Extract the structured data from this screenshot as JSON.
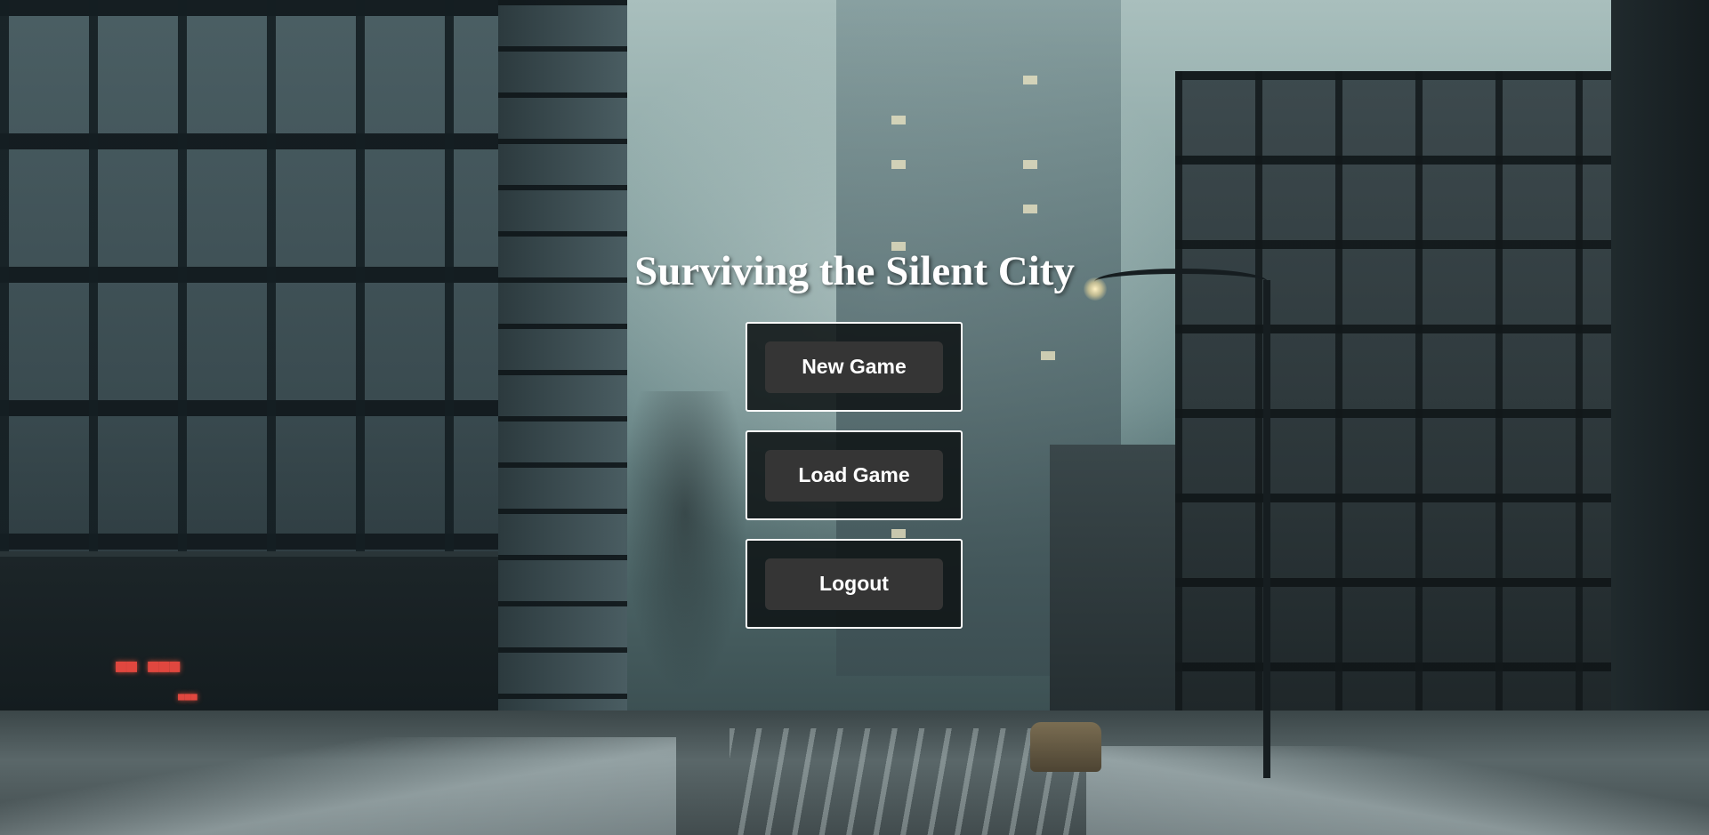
{
  "game": {
    "title": "Surviving the Silent City"
  },
  "menu": {
    "buttons": [
      {
        "label": "New Game"
      },
      {
        "label": "Load Game"
      },
      {
        "label": "Logout"
      }
    ]
  }
}
